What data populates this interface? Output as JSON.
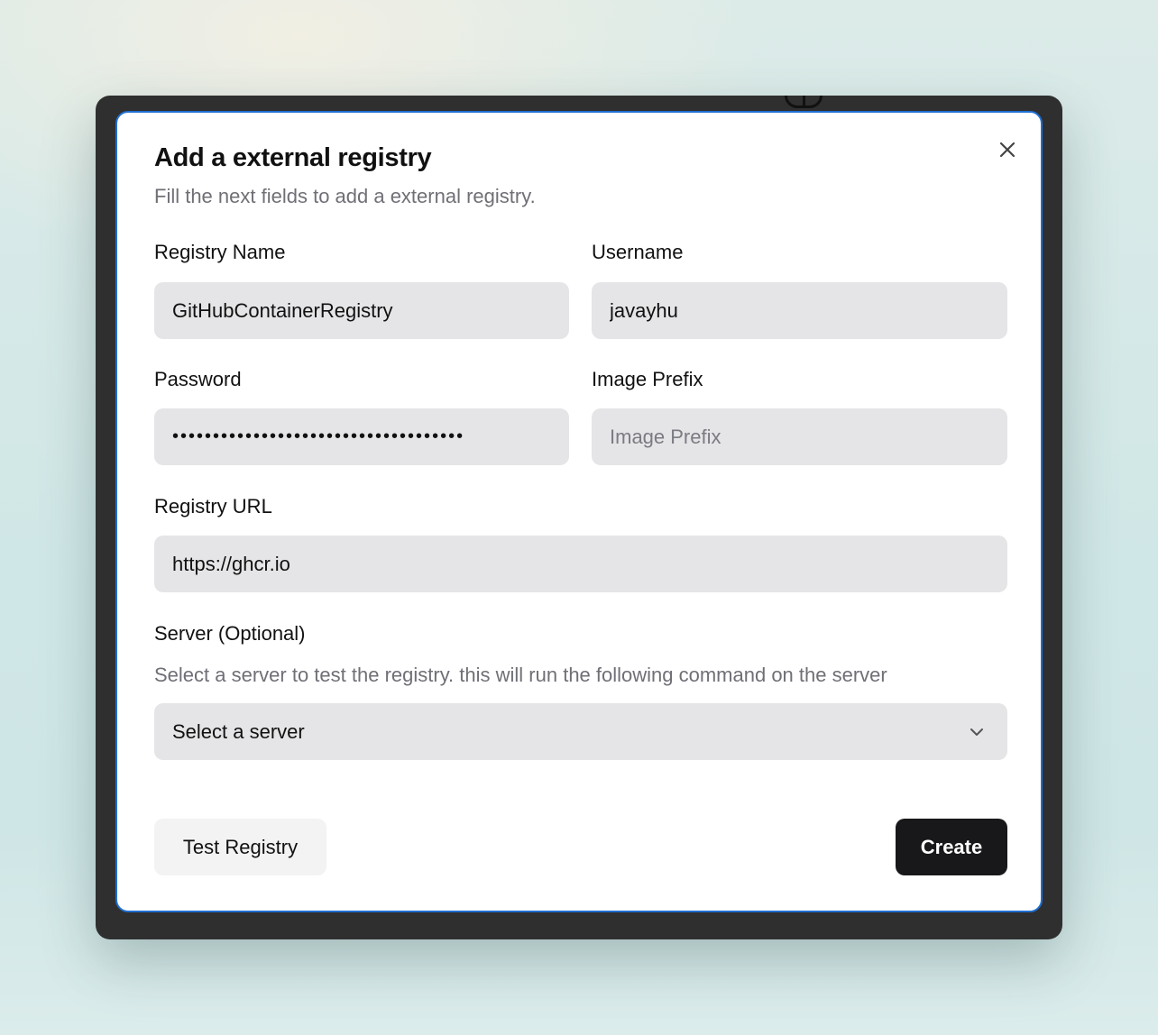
{
  "dialog": {
    "title": "Add a external registry",
    "subtitle": "Fill the next fields to add a external registry.",
    "close_icon": "close-icon"
  },
  "form": {
    "registry_name": {
      "label": "Registry Name",
      "value": "GitHubContainerRegistry"
    },
    "username": {
      "label": "Username",
      "value": "javayhu"
    },
    "password": {
      "label": "Password",
      "value": "ghp_xxxxxxxxxxxxxxxxxxxxxxxxxxxxxxxx"
    },
    "image_prefix": {
      "label": "Image Prefix",
      "value": "",
      "placeholder": "Image Prefix"
    },
    "registry_url": {
      "label": "Registry URL",
      "value": "https://ghcr.io"
    },
    "server": {
      "label": "Server (Optional)",
      "help": "Select a server to test the registry. this will run the following command on the server",
      "selected": "Select a server",
      "icon": "chevron-down-icon"
    }
  },
  "actions": {
    "test_label": "Test Registry",
    "create_label": "Create"
  },
  "colors": {
    "focus_border": "#1f6fd1",
    "input_bg": "#e5e5e7",
    "primary_button": "#18181a"
  }
}
